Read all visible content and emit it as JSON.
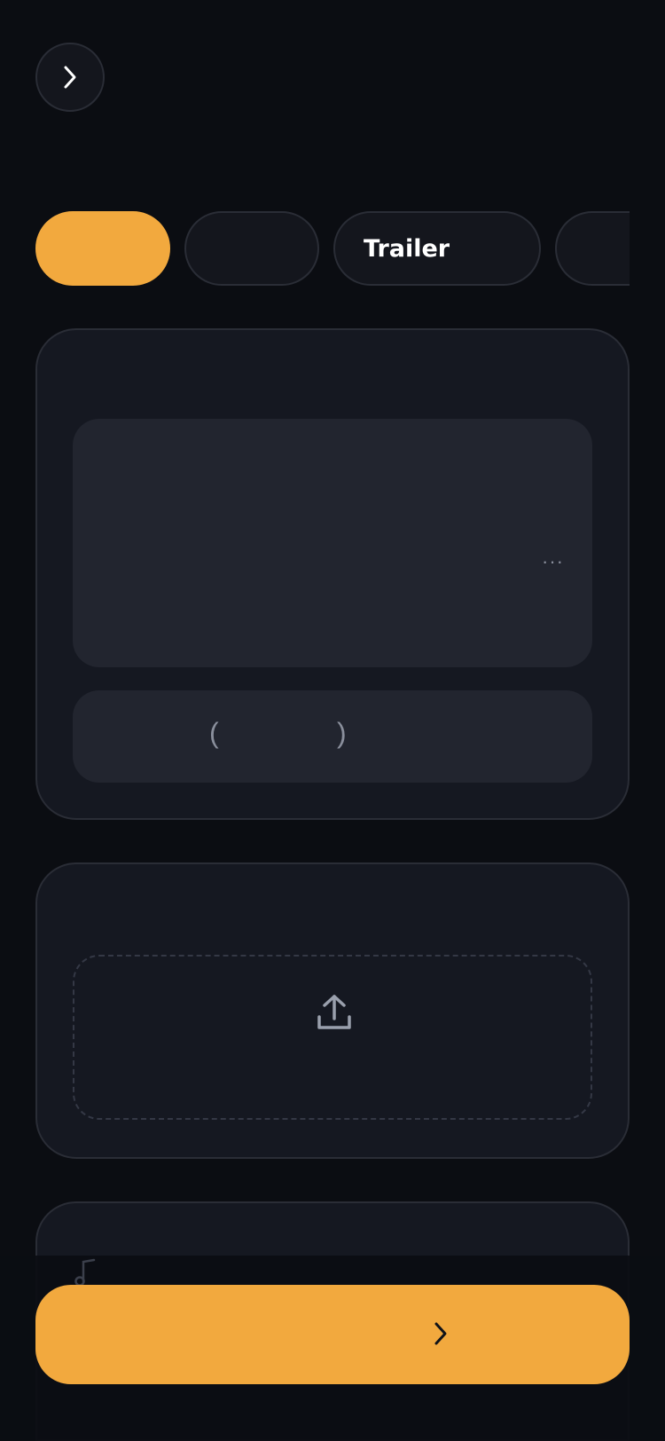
{
  "header": {
    "back_icon": "chevron-right-icon"
  },
  "tabs": [
    {
      "label": "",
      "active": true
    },
    {
      "label": "",
      "active": false
    },
    {
      "label": "Trailer",
      "active": false
    },
    {
      "label": "",
      "active": false
    }
  ],
  "media_card": {
    "menu_icon": "more-dots-icon",
    "menu_glyph": "···",
    "info_open_paren": "(",
    "info_close_paren": ")"
  },
  "upload_card": {
    "icon": "upload-icon"
  },
  "audio_card": {
    "icon": "music-note-icon"
  },
  "cta": {
    "label": "",
    "icon": "chevron-right-icon"
  },
  "colors": {
    "background": "#0b0d12",
    "surface": "#151821",
    "inner_surface": "#22252f",
    "border": "#2a2d36",
    "accent": "#f2a93e",
    "muted_text": "#8a8f9c"
  }
}
